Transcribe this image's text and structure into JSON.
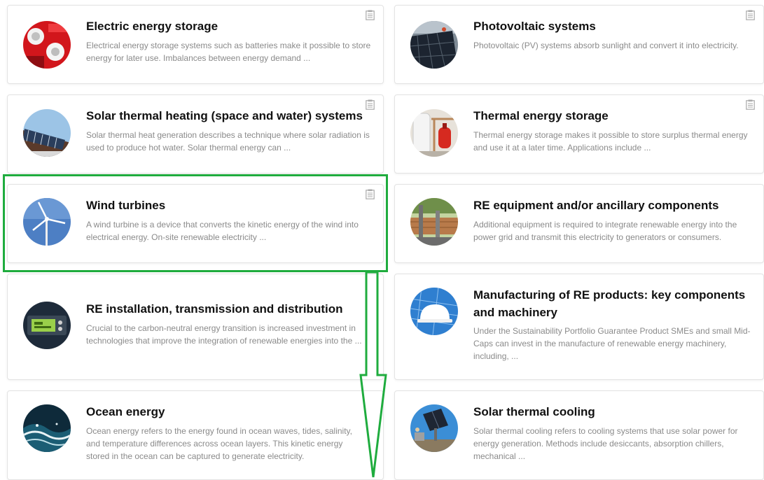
{
  "cards": [
    {
      "title": "Electric energy storage",
      "description": "Electrical energy storage systems such as batteries make it possible to store energy for later use. Imbalances between energy demand ...",
      "icon": "battery-storage-image"
    },
    {
      "title": "Photovoltaic systems",
      "description": "Photovoltaic (PV) systems absorb sunlight and convert it into electricity.",
      "icon": "solar-panels-image"
    },
    {
      "title": "Solar thermal heating (space and water) systems",
      "description": "Solar thermal heat generation describes a technique where solar radiation is used to produce hot water. Solar thermal energy can ...",
      "icon": "solar-thermal-roof-image"
    },
    {
      "title": "Thermal energy storage",
      "description": "Thermal energy storage makes it possible to store surplus thermal energy and use it at a later time. Applications include ...",
      "icon": "thermal-tank-image"
    },
    {
      "title": "Wind turbines",
      "description": "A wind turbine is a device that converts the kinetic energy of the wind into electrical energy. On-site renewable electricity ...",
      "icon": "wind-turbine-image"
    },
    {
      "title": "RE equipment and/or ancillary components",
      "description": "Additional equipment is required to integrate renewable energy into the power grid and transmit this electricity to generators or consumers.",
      "icon": "power-equipment-image"
    },
    {
      "title": "RE installation, transmission and distribution",
      "description": "Crucial to the carbon-neutral energy transition is increased investment in technologies that improve the integration of renewable energies into the ...",
      "icon": "energy-meter-image"
    },
    {
      "title": "Manufacturing of RE products: key components and machinery",
      "description": "Under the Sustainability Portfolio Guarantee Product SMEs and small Mid-Caps can invest in the manufacture of renewable energy machinery, including, ...",
      "icon": "hardhat-solar-image"
    },
    {
      "title": "Ocean energy",
      "description": "Ocean energy refers to the energy found in ocean waves, tides, salinity, and temperature differences across ocean layers. This kinetic energy stored in the ocean can be captured to generate electricity.",
      "icon": "ocean-wave-image"
    },
    {
      "title": "Solar thermal cooling",
      "description": "Solar thermal cooling refers to cooling systems that use solar power for energy generation. Methods include desiccants, absorption chillers, mechanical ...",
      "icon": "solar-cooling-image"
    }
  ],
  "colors": {
    "highlight": "#1fac3e",
    "title": "#111111",
    "description": "#8a8a8a"
  }
}
